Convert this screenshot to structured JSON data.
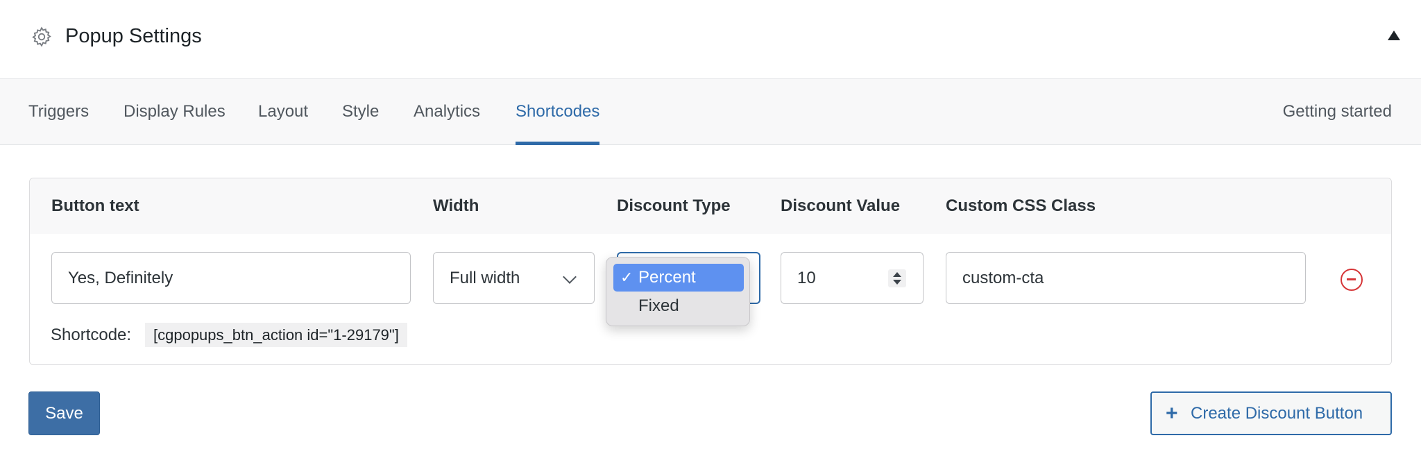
{
  "header": {
    "title": "Popup Settings",
    "gear_icon": "gear-icon",
    "collapse_icon": "triangle-up-icon"
  },
  "tabs": [
    "Triggers",
    "Display Rules",
    "Layout",
    "Style",
    "Analytics",
    "Shortcodes"
  ],
  "active_tab": "Shortcodes",
  "getting_started": "Getting started",
  "table": {
    "columns": [
      "Button text",
      "Width",
      "Discount Type",
      "Discount Value",
      "Custom CSS Class"
    ],
    "row": {
      "button_text": "Yes, Definitely",
      "width": "Full width",
      "discount_type": "Percent",
      "discount_value": "10",
      "css_class": "custom-cta",
      "shortcode_label": "Shortcode:",
      "shortcode": "[cgpopups_btn_action id=\"1-29179\"]"
    }
  },
  "dropdown": {
    "options": [
      "Percent",
      "Fixed"
    ],
    "selected": "Percent",
    "check_glyph": "✓"
  },
  "actions": {
    "save": "Save",
    "create": "Create Discount Button",
    "create_icon": "+"
  },
  "colors": {
    "accent": "#2e6aa8",
    "danger": "#d63638",
    "save_bg": "#3d6ea5",
    "dropdown_selected": "#5e91f0"
  }
}
